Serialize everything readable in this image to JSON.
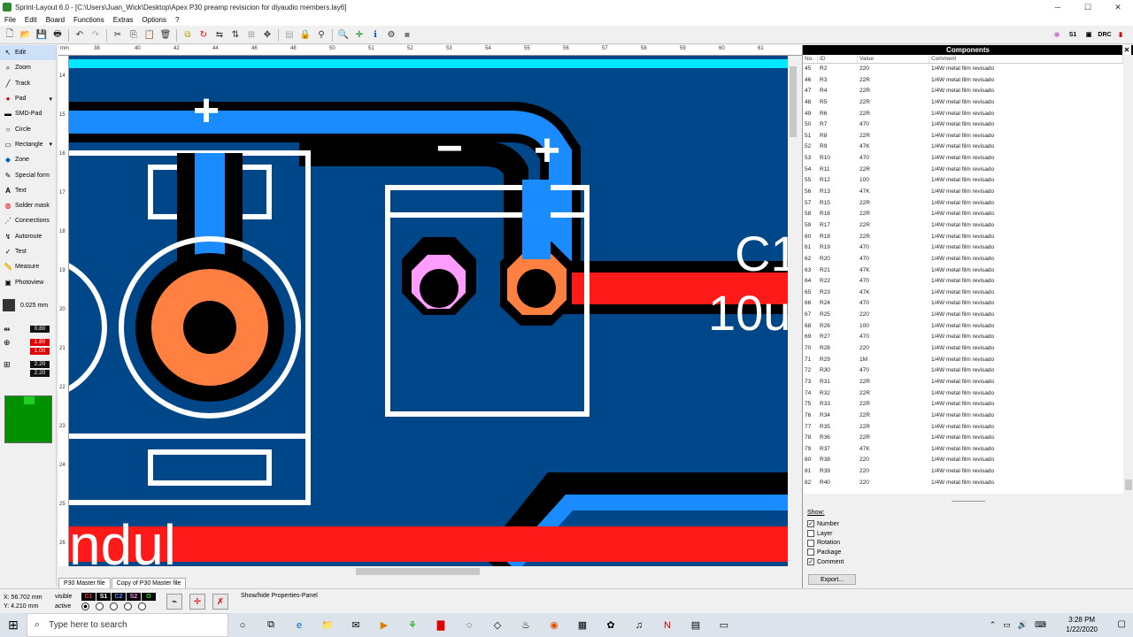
{
  "window": {
    "title": "Sprint-Layout 6.0 - [C:\\Users\\Juan_Wick\\Desktop\\Apex P30 preamp revisicion for diyaudio members.lay6]",
    "minimize": "─",
    "maximize": "☐",
    "close": "✕"
  },
  "menu": [
    "File",
    "Edit",
    "Board",
    "Functions",
    "Extras",
    "Options",
    "?"
  ],
  "tools": [
    {
      "label": "Edit",
      "icon": "pointer"
    },
    {
      "label": "Zoom",
      "icon": "magnifier"
    },
    {
      "label": "Track",
      "icon": "track"
    },
    {
      "label": "Pad",
      "icon": "pad"
    },
    {
      "label": "SMD-Pad",
      "icon": "smd-pad"
    },
    {
      "label": "Circle",
      "icon": "circle"
    },
    {
      "label": "Rectangle",
      "icon": "rectangle"
    },
    {
      "label": "Zone",
      "icon": "zone"
    },
    {
      "label": "Special form",
      "icon": "special-form"
    },
    {
      "label": "Text",
      "icon": "text"
    },
    {
      "label": "Solder mask",
      "icon": "solder-mask"
    },
    {
      "label": "Connections",
      "icon": "connections"
    },
    {
      "label": "Autoroute",
      "icon": "autoroute"
    },
    {
      "label": "Test",
      "icon": "test"
    },
    {
      "label": "Measure",
      "icon": "measure"
    },
    {
      "label": "Photoview",
      "icon": "photoview"
    }
  ],
  "grid": {
    "value": "0.025 mm"
  },
  "params": {
    "track_width": "0.80",
    "pad_outer": "1.80",
    "pad_inner": "1.00",
    "smd_w": "2.20",
    "smd_h": "2.20"
  },
  "ruler": {
    "h": [
      "38",
      "40",
      "42",
      "44",
      "46",
      "48",
      "50",
      "51",
      "52",
      "53",
      "54",
      "55",
      "56",
      "57",
      "58",
      "59",
      "60",
      "61"
    ],
    "v": [
      "14",
      "15",
      "16",
      "17",
      "18",
      "19",
      "20",
      "21",
      "22",
      "23",
      "24",
      "25",
      "26"
    ],
    "unit": "mm"
  },
  "canvas": {
    "labels": {
      "plus1": "+",
      "minus": "−",
      "plus2": "+",
      "c1": "C1",
      "c1val": "10u",
      "bottomtext": "ndul"
    }
  },
  "tabs": [
    "P30 Master file",
    "Copy of P30 Master file"
  ],
  "status": {
    "x": "X:  56.702 mm",
    "y": "Y:    4.210 mm",
    "visible": "visible",
    "active": "active",
    "message": "Show/hide Properties-Panel",
    "layers": [
      "C1",
      "S1",
      "C2",
      "S2",
      "O"
    ]
  },
  "panel": {
    "title": "Components",
    "headers": [
      "No.",
      "ID",
      "Value",
      "Comment"
    ],
    "rows": [
      [
        "45",
        "R2",
        "220",
        "1/4W metal film  revisado"
      ],
      [
        "46",
        "R3",
        "22R",
        "1/4W metal film revisado"
      ],
      [
        "47",
        "R4",
        "22R",
        "1/4W metal film revisado"
      ],
      [
        "48",
        "R5",
        "22R",
        "1/4W metal film revisado"
      ],
      [
        "49",
        "R6",
        "22R",
        "1/4W metal film revisado"
      ],
      [
        "50",
        "R7",
        "470",
        "1/4W metal film revisado"
      ],
      [
        "51",
        "R8",
        "22R",
        "1/4W metal film revisado"
      ],
      [
        "52",
        "R9",
        "47K",
        "1/4W metal film revisado"
      ],
      [
        "53",
        "R10",
        "470",
        "1/4W metal film revisado"
      ],
      [
        "54",
        "R11",
        "22R",
        "1/4W metal film revisado"
      ],
      [
        "55",
        "R12",
        "100",
        "1/4W metal film revisado"
      ],
      [
        "56",
        "R13",
        "47K",
        "1/4W metal film revisado"
      ],
      [
        "57",
        "R15",
        "22R",
        "1/4W metal film revisado"
      ],
      [
        "58",
        "R16",
        "22R",
        "1/4W metal film revisado"
      ],
      [
        "59",
        "R17",
        "22R",
        "1/4W metal film revisado"
      ],
      [
        "60",
        "R18",
        "22R",
        "1/4W metal film revisado"
      ],
      [
        "61",
        "R19",
        "470",
        "1/4W metal film revisado"
      ],
      [
        "62",
        "R20",
        "470",
        "1/4W metal film revisado"
      ],
      [
        "63",
        "R21",
        "47K",
        "1/4W metal film revisado"
      ],
      [
        "64",
        "R22",
        "470",
        "1/4W metal film revisado"
      ],
      [
        "65",
        "R23",
        "47K",
        "1/4W metal film revisado"
      ],
      [
        "66",
        "R24",
        "470",
        "1/4W metal film revisado"
      ],
      [
        "67",
        "R25",
        "220",
        "1/4W metal film revisado"
      ],
      [
        "68",
        "R26",
        "100",
        "1/4W metal film revisado"
      ],
      [
        "69",
        "R27",
        "470",
        "1/4W metal film revisado"
      ],
      [
        "70",
        "R28",
        "220",
        "1/4W metal film revisado"
      ],
      [
        "71",
        "R29",
        "1M",
        "1/4W metal film revisado"
      ],
      [
        "72",
        "R30",
        "470",
        "1/4W metal film revisado"
      ],
      [
        "73",
        "R31",
        "22R",
        "1/4W metal film revisado"
      ],
      [
        "74",
        "R32",
        "22R",
        "1/4W metal film revisado"
      ],
      [
        "75",
        "R33",
        "22R",
        "1/4W metal film revisado"
      ],
      [
        "76",
        "R34",
        "22R",
        "1/4W metal film revisado"
      ],
      [
        "77",
        "R35",
        "22R",
        "1/4W metal film revisado"
      ],
      [
        "78",
        "R36",
        "22R",
        "1/4W metal film revisado"
      ],
      [
        "79",
        "R37",
        "47K",
        "1/4W metal film revisado"
      ],
      [
        "80",
        "R38",
        "220",
        "1/4W metal film revisado"
      ],
      [
        "81",
        "R39",
        "220",
        "1/4W metal film revisado"
      ],
      [
        "82",
        "R40",
        "220",
        "1/4W metal film revisado"
      ]
    ],
    "show_title": "Show:",
    "show": [
      {
        "label": "Number",
        "checked": true
      },
      {
        "label": "Layer",
        "checked": false
      },
      {
        "label": "Rotation",
        "checked": false
      },
      {
        "label": "Package",
        "checked": false
      },
      {
        "label": "Comment",
        "checked": true
      }
    ],
    "export": "Export..."
  },
  "taskbar": {
    "search_placeholder": "Type here to search",
    "time": "3:28 PM",
    "date": "1/22/2020"
  }
}
